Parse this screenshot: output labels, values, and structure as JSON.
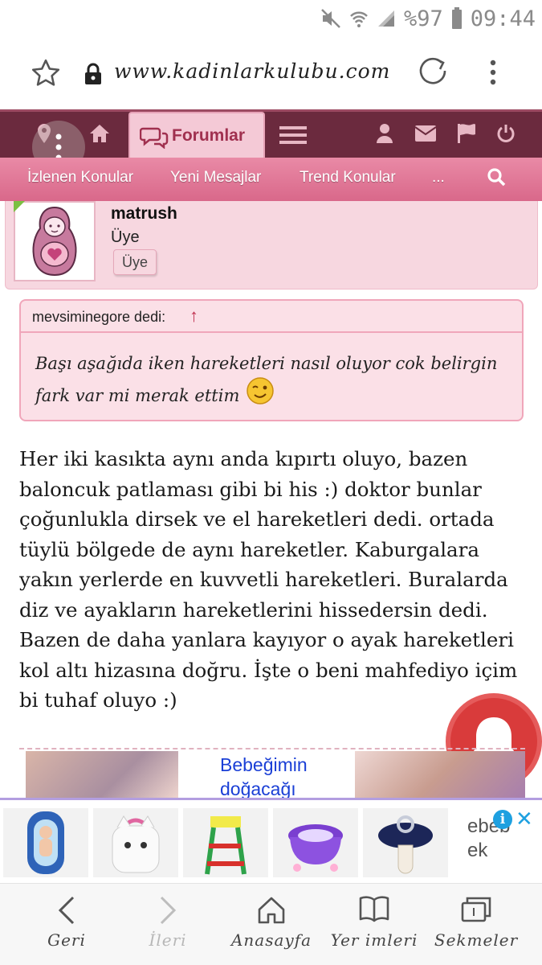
{
  "status_bar": {
    "battery": "%97",
    "time": "09:44"
  },
  "browser": {
    "url": "www.kadinlarkulubu.com"
  },
  "forum_nav": {
    "active_tab": "Forumlar"
  },
  "sub_nav": {
    "items": [
      "İzlenen Konular",
      "Yeni Mesajlar",
      "Trend Konular",
      "..."
    ]
  },
  "user": {
    "name": "matrush",
    "title": "Üye",
    "badge": "Üye"
  },
  "quote": {
    "author": "mevsiminegore dedi:",
    "arrow": "↑",
    "text": "Başı aşağıda iken hareketleri nasıl oluyor cok belirgin fark var mi merak ettim"
  },
  "post": {
    "text": "Her iki kasıkta aynı anda kıpırtı oluyo, bazen baloncuk patlaması gibi bi his :) doktor bunlar çoğunlukla dirsek ve el hareketleri dedi. ortada tüylü bölgede de aynı hareketler. Kaburgalara yakın yerlerde en kuvvetli hareketleri. Buralarda diz ve ayakların hareketlerini hissedersin dedi. Bazen de daha yanlara kayıyor o ayak hareketleri kol altı hizasına doğru. İşte o beni mahfediyo içim bi tuhaf oluyo :)"
  },
  "ad": {
    "title": "Bebeğimin doğacağı",
    "brand": "ebebek",
    "info": "i",
    "close": "✕"
  },
  "bottom_bar": {
    "back": "Geri",
    "forward": "İleri",
    "home": "Anasayfa",
    "bookmarks": "Yer imleri",
    "tabs": "Sekmeler"
  },
  "colors": {
    "nav_dark": "#6b2a3e",
    "pink_accent": "#e98aa6",
    "tab_text": "#a0304f",
    "bell_red": "#d93b3b",
    "ad_link": "#1a3fd6"
  }
}
